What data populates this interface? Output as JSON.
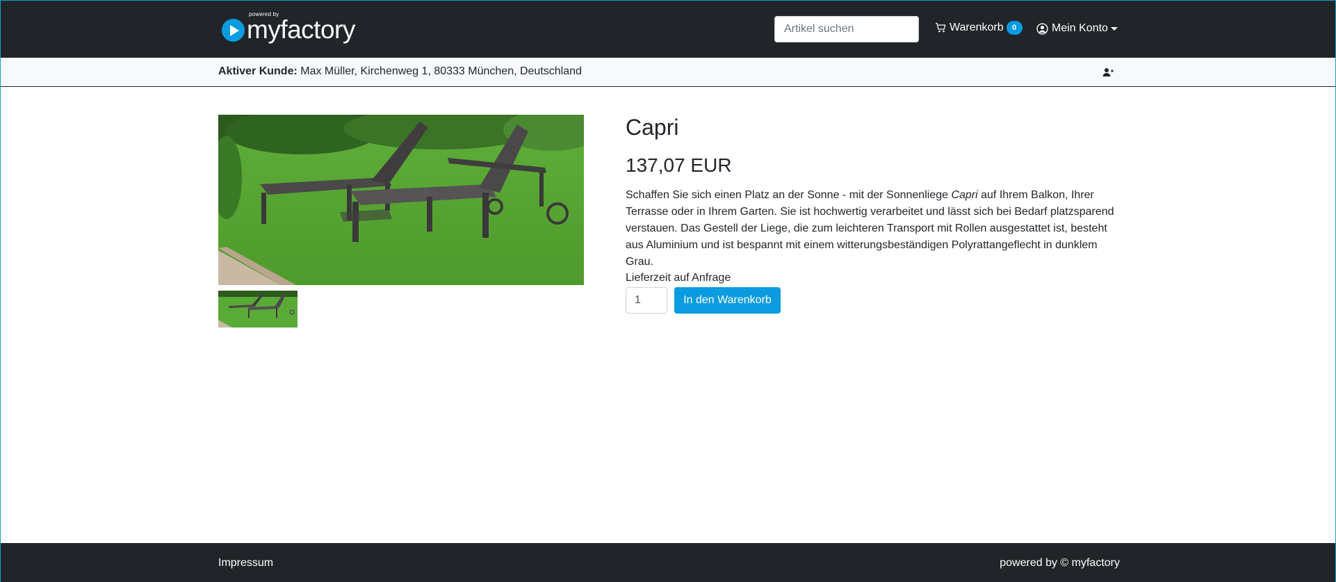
{
  "header": {
    "brand_powered": "powered by",
    "brand_name": "myfactory",
    "search_placeholder": "Artikel suchen",
    "cart_label": "Warenkorb",
    "cart_count": "0",
    "account_label": "Mein Konto"
  },
  "customer": {
    "label": "Aktiver Kunde:",
    "value": "Max Müller, Kirchenweg 1, 80333 München, Deutschland"
  },
  "product": {
    "title": "Capri",
    "price": "137,07 EUR",
    "description_pre": "Schaffen Sie sich einen Platz an der Sonne - mit der Sonnenliege ",
    "description_em": "Capri",
    "description_post": " auf Ihrem Balkon, Ihrer Terrasse oder in Ihrem Garten. Sie ist hochwertig verarbeitet und lässt sich bei Bedarf platzsparend verstauen. Das Gestell der Liege, die zum leichteren Transport mit Rollen ausgestattet ist, besteht aus Aluminium und ist bespannt mit einem witterungsbeständigen Polyrattangeflecht in dunklem Grau.",
    "delivery": "Lieferzeit auf Anfrage",
    "quantity": "1",
    "add_to_cart": "In den Warenkorb"
  },
  "footer": {
    "impressum": "Impressum",
    "powered": "powered by © myfactory"
  },
  "colors": {
    "navbar": "#212529",
    "accent": "#0b9be0",
    "customer_bar": "#f8f9fa"
  }
}
